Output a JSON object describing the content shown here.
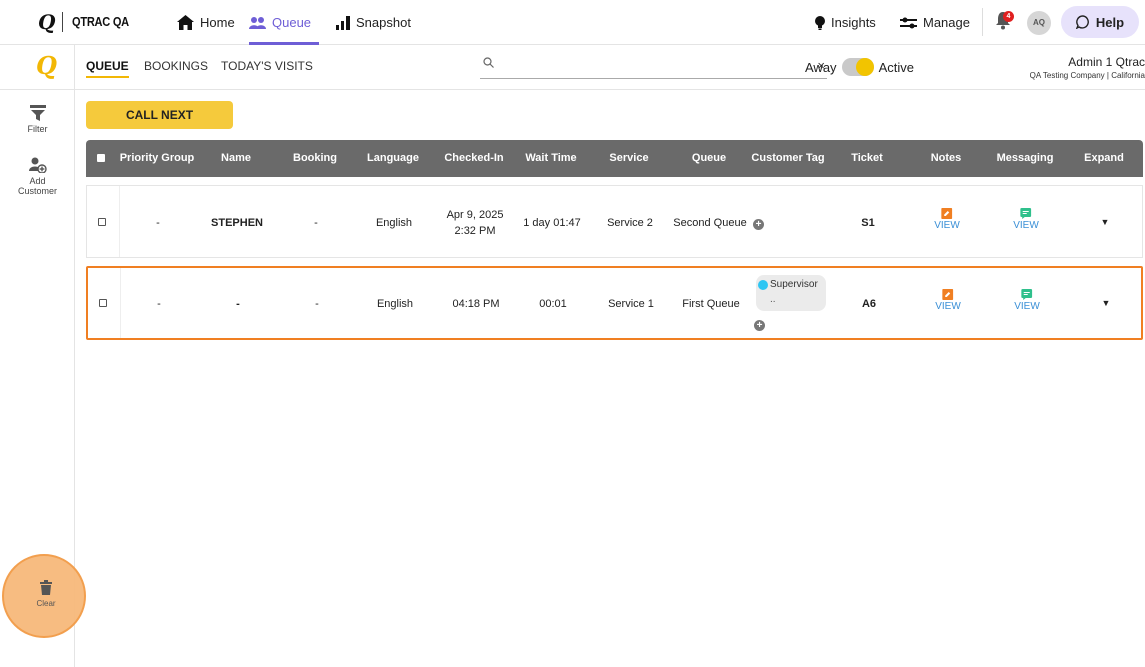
{
  "topnav": {
    "brand": "QTRAC QA",
    "home": "Home",
    "queue": "Queue",
    "snapshot": "Snapshot",
    "insights": "Insights",
    "manage": "Manage",
    "notifications": "4",
    "avatar": "AQ",
    "help": "Help",
    "accent": "#6e5ed6"
  },
  "sidebar": {
    "filter": "Filter",
    "add_customer_line1": "Add",
    "add_customer_line2": "Customer",
    "clear": "Clear"
  },
  "subheader": {
    "tabs": [
      "QUEUE",
      "BOOKINGS",
      "TODAY'S VISITS"
    ],
    "search_value": "",
    "search_clear": "×",
    "away": "Away",
    "active": "Active",
    "user_name": "Admin 1 Qtrac",
    "user_company": "QA Testing Company | California"
  },
  "call_next": "CALL NEXT",
  "table": {
    "headers": [
      "Priority Group",
      "Name",
      "Booking",
      "Language",
      "Checked-In",
      "Wait Time",
      "Service",
      "Queue",
      "Customer Tag",
      "Ticket",
      "Notes",
      "Messaging",
      "Expand"
    ],
    "rows": [
      {
        "priority": "-",
        "name": "STEPHEN",
        "booking": "-",
        "language": "English",
        "checked_in_date": "Apr 9, 2025",
        "checked_in_time": "2:32 PM",
        "wait": "1 day 01:47",
        "service": "Service 2",
        "queue": "Second Queue",
        "tag": "",
        "ticket": "S1",
        "notes": "VIEW",
        "messaging": "VIEW",
        "expand": "▼"
      },
      {
        "priority": "-",
        "name": "-",
        "booking": "-",
        "language": "English",
        "checked_in_time": "04:18 PM",
        "wait": "00:01",
        "service": "Service 1",
        "queue": "First Queue",
        "tag": "Supervisor",
        "tag_more": "..",
        "ticket": "A6",
        "notes": "VIEW",
        "messaging": "VIEW",
        "expand": "▼"
      }
    ]
  }
}
